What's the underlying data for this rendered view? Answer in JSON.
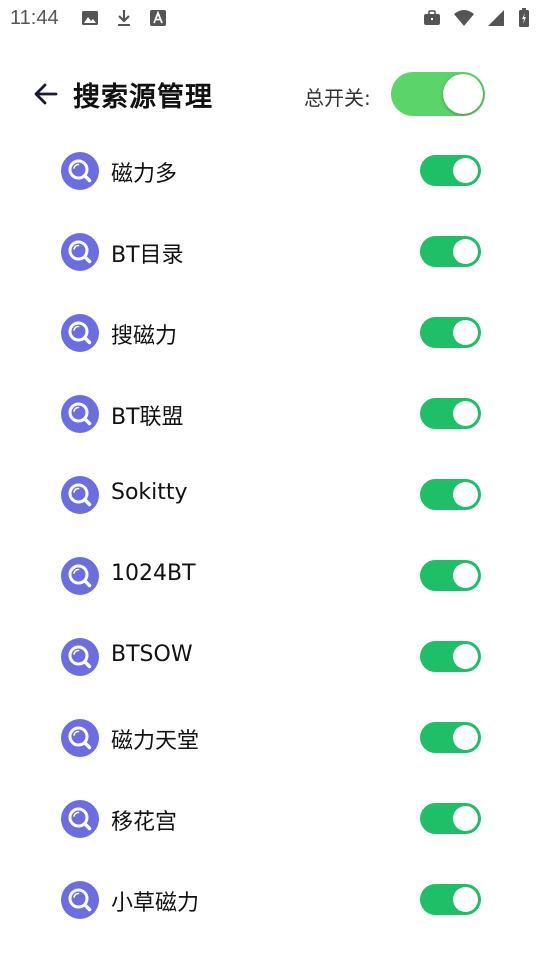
{
  "status_bar": {
    "time": "11:44",
    "left_icons": [
      "image-icon",
      "download-icon",
      "font-icon"
    ],
    "right_icons": [
      "briefcase-icon",
      "wifi-icon",
      "signal-icon",
      "battery-charging-icon"
    ]
  },
  "header": {
    "title": "搜索源管理",
    "master_switch_label": "总开关:",
    "master_switch_on": true
  },
  "colors": {
    "master_switch_bg": "#5bd46a",
    "row_switch_bg": "#1fbf68",
    "icon_color": "#6a6ee0"
  },
  "sources": [
    {
      "name": "磁力多",
      "enabled": true,
      "icon": "search-icon"
    },
    {
      "name": "BT目录",
      "enabled": true,
      "icon": "search-icon"
    },
    {
      "name": "搜磁力",
      "enabled": true,
      "icon": "search-icon"
    },
    {
      "name": "BT联盟",
      "enabled": true,
      "icon": "search-icon"
    },
    {
      "name": "Sokitty",
      "enabled": true,
      "icon": "search-icon"
    },
    {
      "name": "1024BT",
      "enabled": true,
      "icon": "search-icon"
    },
    {
      "name": "BTSOW",
      "enabled": true,
      "icon": "search-icon"
    },
    {
      "name": "磁力天堂",
      "enabled": true,
      "icon": "search-icon"
    },
    {
      "name": "移花宫",
      "enabled": true,
      "icon": "search-icon"
    },
    {
      "name": "小草磁力",
      "enabled": true,
      "icon": "search-icon"
    }
  ]
}
